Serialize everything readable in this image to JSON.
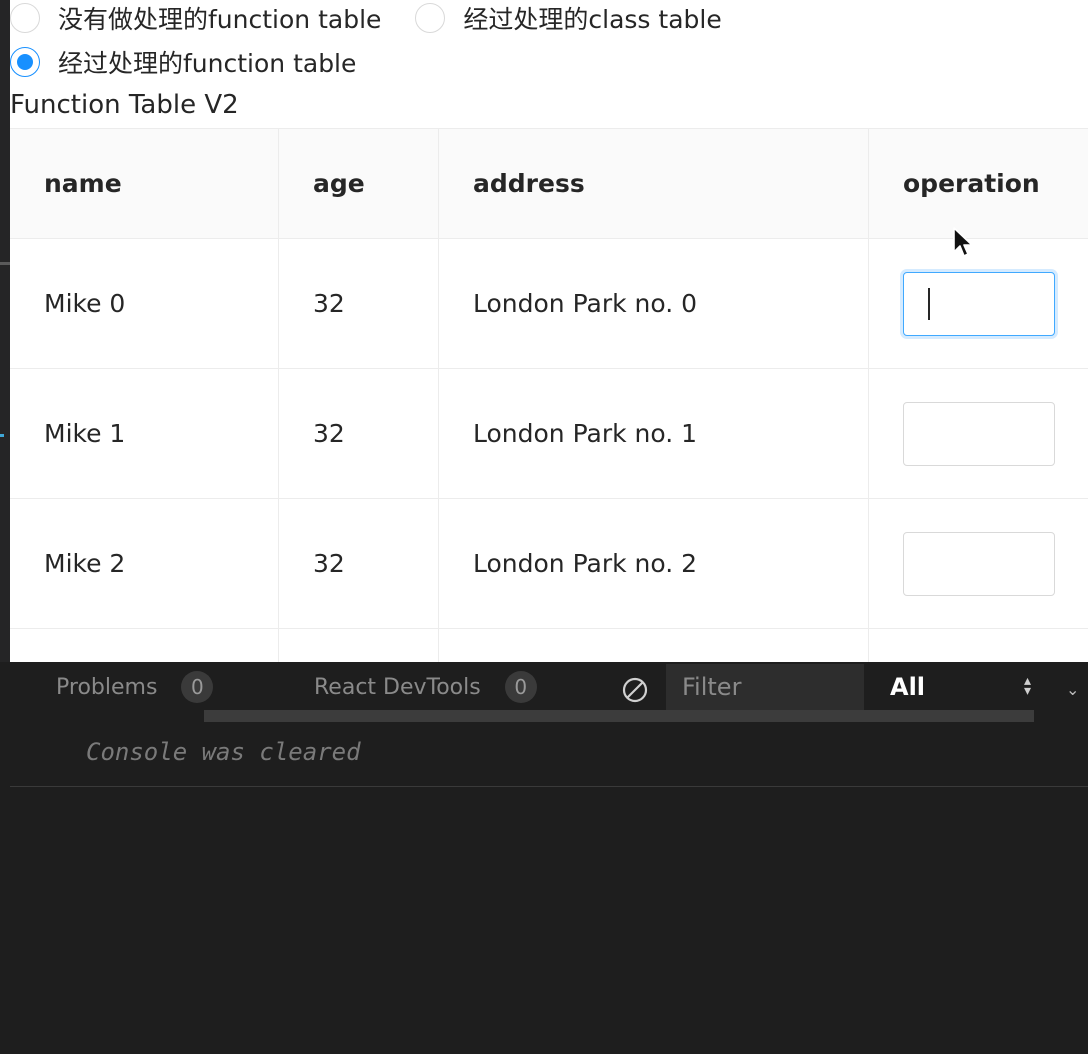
{
  "radio_group": {
    "options": [
      {
        "label": "没有做处理的function table",
        "checked": false
      },
      {
        "label": "经过处理的class table",
        "checked": false
      },
      {
        "label": "经过处理的function table",
        "checked": true
      }
    ]
  },
  "table": {
    "title": "Function Table V2",
    "columns": [
      "name",
      "age",
      "address",
      "operation"
    ],
    "rows": [
      {
        "name": "Mike 0",
        "age": "32",
        "address": "London Park no. 0",
        "input_value": "",
        "focused": true
      },
      {
        "name": "Mike 1",
        "age": "32",
        "address": "London Park no. 1",
        "input_value": "",
        "focused": false
      },
      {
        "name": "Mike 2",
        "age": "32",
        "address": "London Park no. 2",
        "input_value": "",
        "focused": false
      }
    ]
  },
  "console": {
    "tabs": [
      {
        "label": "Problems",
        "count": "0"
      },
      {
        "label": "React DevTools",
        "count": "0"
      }
    ],
    "filter_placeholder": "Filter",
    "level": "All",
    "message": "Console was cleared"
  },
  "colors": {
    "accent": "#1890ff",
    "console_bg": "#1e1e1e"
  },
  "icons": {
    "clear": "clear-console-icon",
    "cursor": "mouse-pointer-icon",
    "collapse": "chevron-down-icon"
  }
}
